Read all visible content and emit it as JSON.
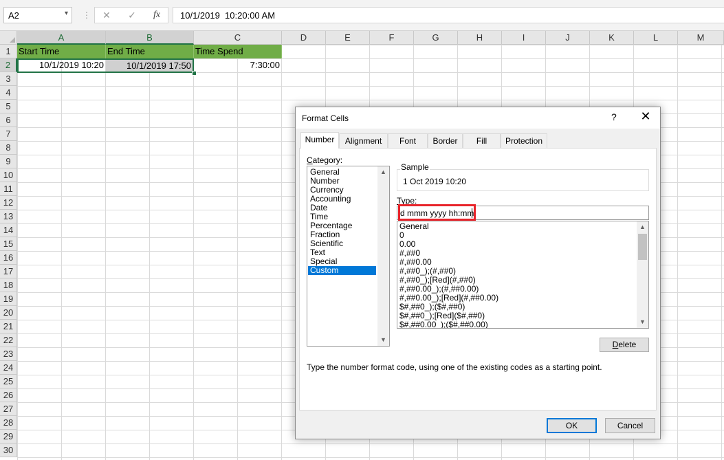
{
  "formula_bar": {
    "name_box": "A2",
    "name_box_arrow": "▾",
    "separator": "⋮",
    "cancel_icon": "✕",
    "enter_icon": "✓",
    "fx_icon": "fx",
    "formula": "10/1/2019  10:20:00 AM"
  },
  "columns": [
    "A",
    "B",
    "C",
    "D",
    "E",
    "F",
    "G",
    "H",
    "I",
    "J",
    "K",
    "L",
    "M"
  ],
  "rows": [
    "1",
    "2",
    "3",
    "4",
    "5",
    "6",
    "7",
    "8",
    "9",
    "10",
    "11",
    "12",
    "13",
    "14",
    "15",
    "16",
    "17",
    "18",
    "19",
    "20",
    "21",
    "22",
    "23",
    "24",
    "25",
    "26",
    "27",
    "28",
    "29",
    "30"
  ],
  "cells": {
    "a1": "Start Time",
    "b1": "End Time",
    "c1": "Time Spend",
    "a2": "10/1/2019 10:20",
    "b2": "10/1/2019 17:50",
    "c2": "7:30:00"
  },
  "colors": {
    "header_fill": "#70ad47",
    "selection": "#217346",
    "highlight_box": "#e8232a",
    "list_selection": "#0078d7"
  },
  "dialog": {
    "title": "Format Cells",
    "help": "?",
    "close": "✕",
    "tabs": [
      "Number",
      "Alignment",
      "Font",
      "Border",
      "Fill",
      "Protection"
    ],
    "active_tab": "Number",
    "category_label_u": "C",
    "category_label_rest": "ategory:",
    "categories": [
      "General",
      "Number",
      "Currency",
      "Accounting",
      "Date",
      "Time",
      "Percentage",
      "Fraction",
      "Scientific",
      "Text",
      "Special",
      "Custom"
    ],
    "selected_category": "Custom",
    "sample_label": "Sample",
    "sample_value": "1 Oct 2019 10:20",
    "type_label_u": "T",
    "type_label_rest": "ype:",
    "type_value": "d mmm yyyy hh:mm",
    "type_list": [
      "General",
      "0",
      "0.00",
      "#,##0",
      "#,##0.00",
      "#,##0_);(#,##0)",
      "#,##0_);[Red](#,##0)",
      "#,##0.00_);(#,##0.00)",
      "#,##0.00_);[Red](#,##0.00)",
      "$#,##0_);($#,##0)",
      "$#,##0_);[Red]($#,##0)",
      "$#,##0.00_);($#,##0.00)"
    ],
    "delete_u": "D",
    "delete_rest": "elete",
    "hint": "Type the number format code, using one of the existing codes as a starting point.",
    "ok": "OK",
    "cancel": "Cancel",
    "scroll_up": "▲",
    "scroll_down": "▼"
  }
}
